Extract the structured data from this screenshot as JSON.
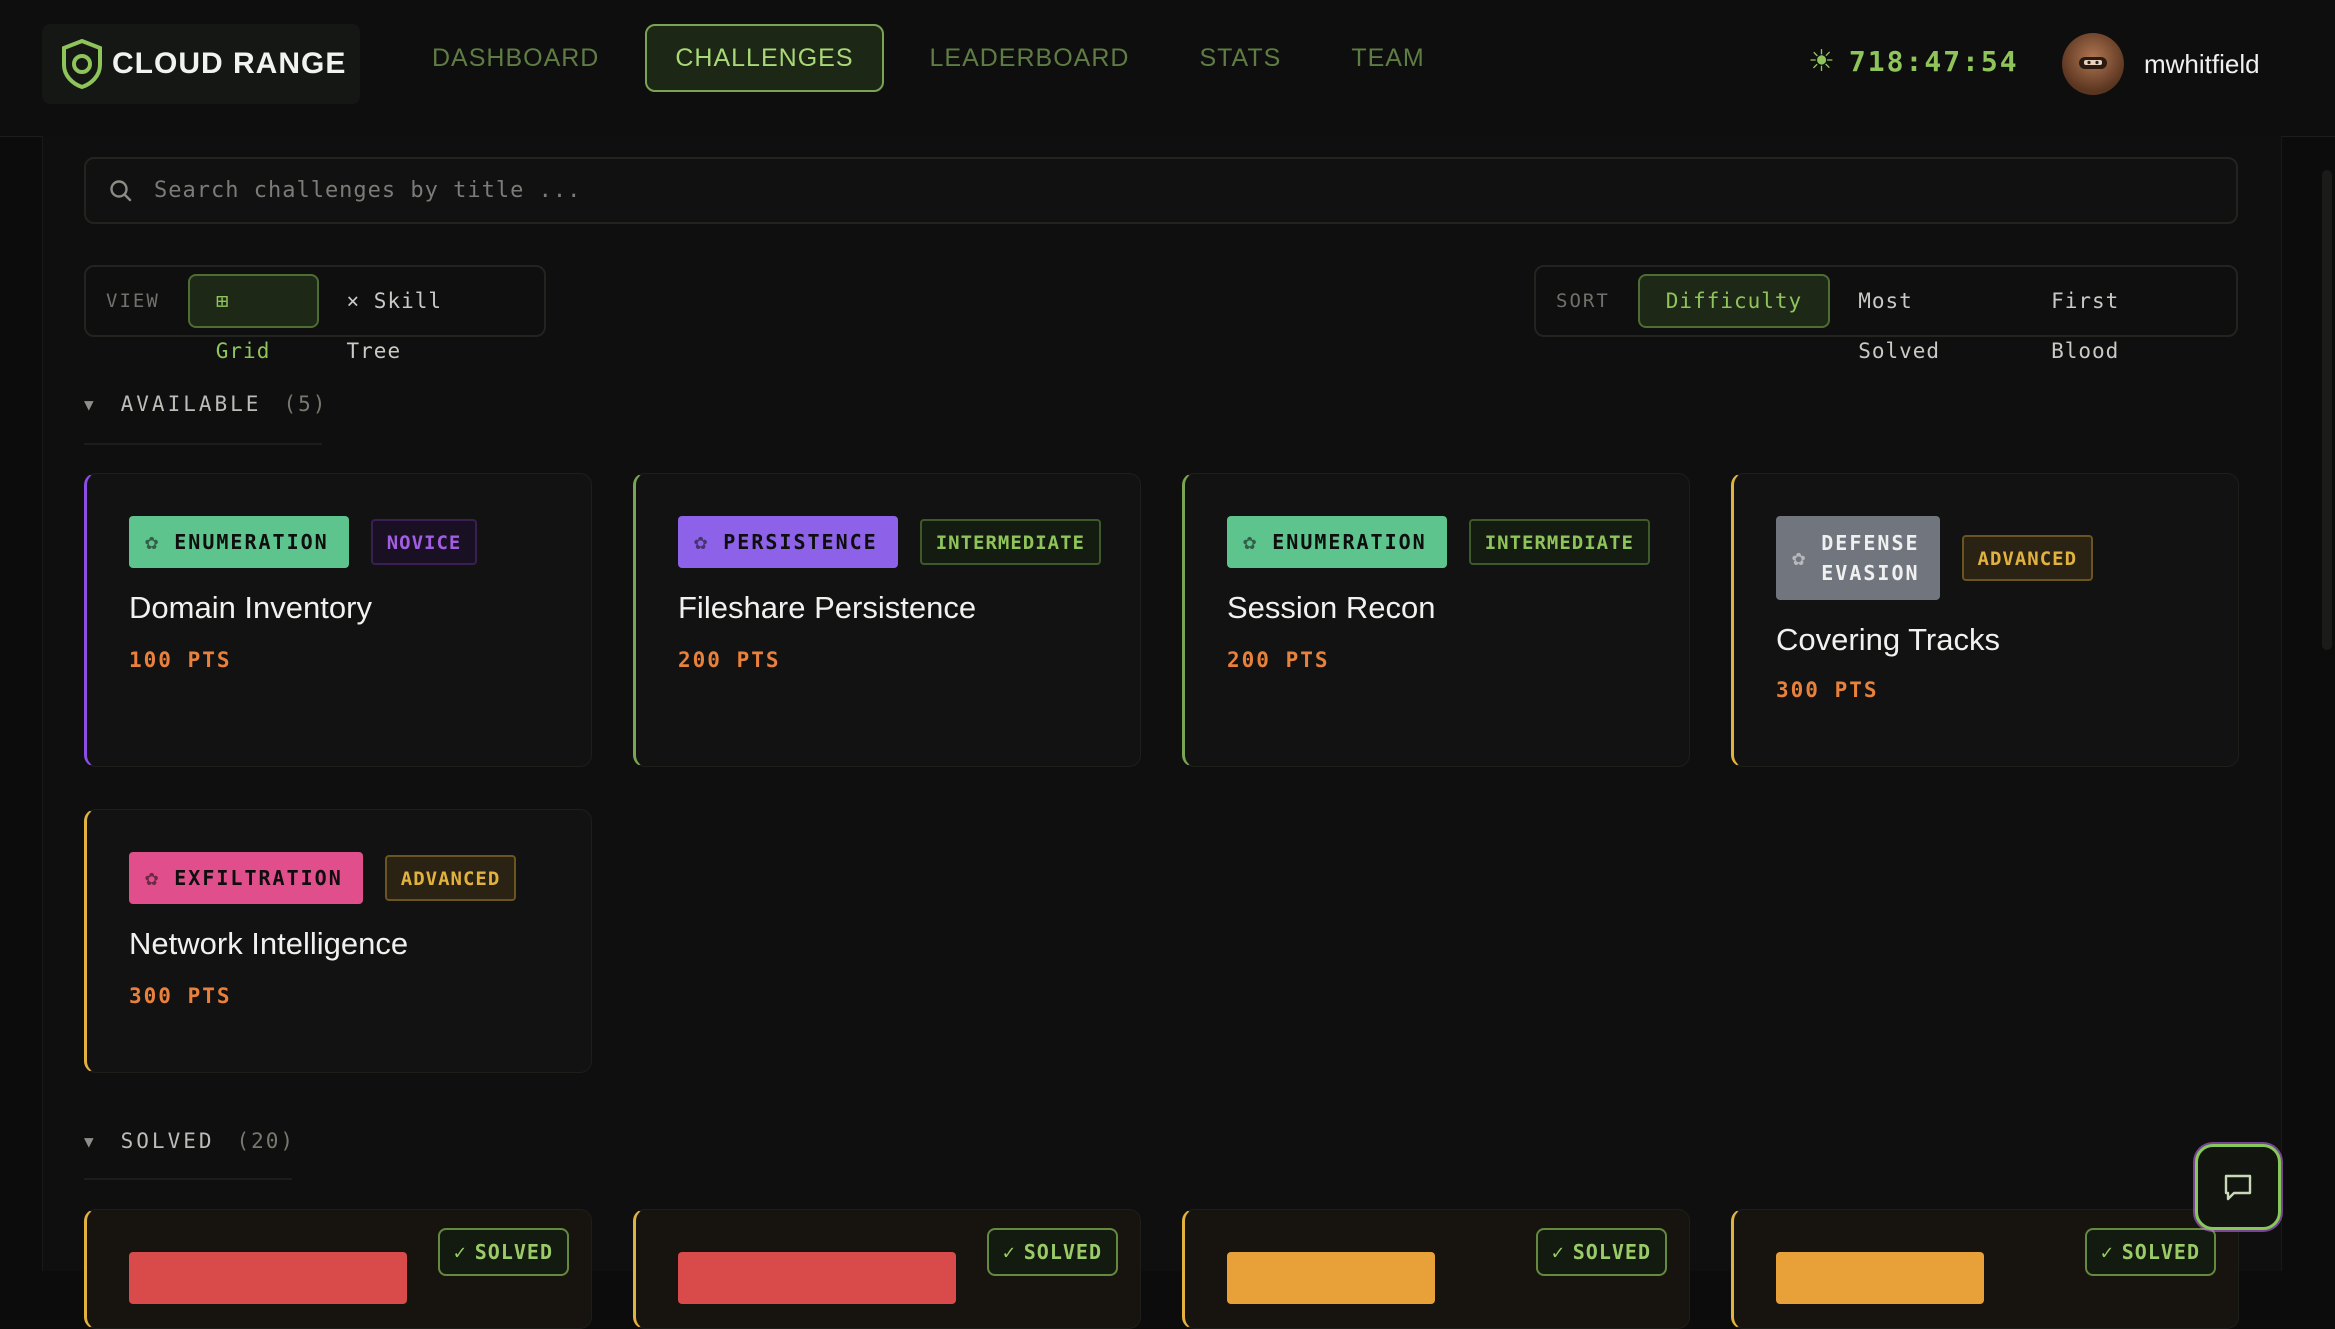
{
  "app": {
    "brand": "CLOUD RANGE"
  },
  "nav": {
    "items": [
      {
        "label": "DASHBOARD",
        "active": false
      },
      {
        "label": "CHALLENGES",
        "active": true
      },
      {
        "label": "LEADERBOARD",
        "active": false
      },
      {
        "label": "STATS",
        "active": false
      },
      {
        "label": "TEAM",
        "active": false
      }
    ]
  },
  "timer": {
    "value": "718:47:54",
    "icon": "sun-icon"
  },
  "user": {
    "name": "mwhitfield"
  },
  "search": {
    "placeholder": "Search challenges by title ..."
  },
  "view": {
    "label": "VIEW",
    "options": [
      {
        "label": "⊞ Grid",
        "active": true
      },
      {
        "label": "× Skill Tree",
        "active": false
      }
    ]
  },
  "sort": {
    "label": "SORT",
    "options": [
      {
        "label": "Difficulty",
        "active": true
      },
      {
        "label": "Most Solved",
        "active": false
      },
      {
        "label": "First Blood",
        "active": false
      }
    ]
  },
  "available": {
    "label": "AVAILABLE",
    "count": "(5)",
    "cards": [
      {
        "category": "ENUMERATION",
        "category_color": "#5ec48d",
        "difficulty": "NOVICE",
        "difficulty_color": "#a25ee0",
        "difficulty_bg": "#1a1024",
        "accent": "#8b4de6",
        "title": "Domain Inventory",
        "points": "100 PTS"
      },
      {
        "category": "PERSISTENCE",
        "category_color": "#8d61e8",
        "difficulty": "INTERMEDIATE",
        "difficulty_color": "#8fc45b",
        "difficulty_bg": "#141b10",
        "accent": "#7aa453",
        "title": "Fileshare Persistence",
        "points": "200 PTS"
      },
      {
        "category": "ENUMERATION",
        "category_color": "#5ec48d",
        "difficulty": "INTERMEDIATE",
        "difficulty_color": "#8fc45b",
        "difficulty_bg": "#141b10",
        "accent": "#7aa453",
        "title": "Session Recon",
        "points": "200 PTS"
      },
      {
        "category": "DEFENSE EVASION",
        "category_lines": [
          "DEFENSE",
          "EVASION"
        ],
        "category_color": "#71757e",
        "difficulty": "ADVANCED",
        "difficulty_color": "#e2b23f",
        "difficulty_bg": "#2a2212",
        "accent": "#e2b23f",
        "title": "Covering Tracks",
        "points": "300 PTS"
      },
      {
        "category": "EXFILTRATION",
        "category_color": "#e04e8c",
        "difficulty": "ADVANCED",
        "difficulty_color": "#e2b23f",
        "difficulty_bg": "#2a2212",
        "accent": "#e2b23f",
        "title": "Network Intelligence",
        "points": "300 PTS"
      }
    ]
  },
  "solved": {
    "label": "SOLVED",
    "count": "(20)",
    "badge": "SOLVED",
    "cards": [
      {
        "category_color": "#d94a4a",
        "accent": "#e2b23f"
      },
      {
        "category_color": "#d94a4a",
        "accent": "#e2b23f"
      },
      {
        "category_color": "#e8a039",
        "accent": "#e2b23f"
      },
      {
        "category_color": "#e8a039",
        "accent": "#e2b23f"
      }
    ]
  }
}
